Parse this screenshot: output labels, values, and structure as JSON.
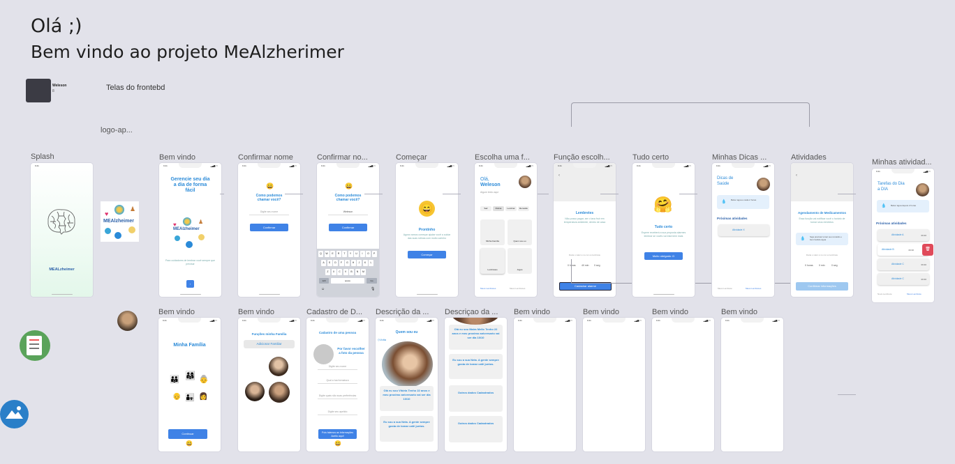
{
  "header": {
    "greeting": "Olá ;)",
    "title": "Bem vindo ao projeto MeAlzherimer"
  },
  "author": {
    "name": "Weleson",
    "sub": "8"
  },
  "section_label": "Telas do frontebd",
  "logo_label": "logo-ap...",
  "frame_labels": {
    "splash": "Splash",
    "bem_vindo": "Bem vindo",
    "confirmar_nome": "Confirmar nome",
    "confirmar_no": "Confirmar no...",
    "comecar": "Começar",
    "escolha": "Escolha uma f...",
    "funcao": "Função escolh...",
    "tudo_certo": "Tudo certo",
    "minhas_dicas": "Minhas Dicas ...",
    "atividades": "Atividades",
    "minhas_atividades": "Minhas atividad...",
    "cadastro": "Cadastro de D...",
    "descricao_a": "Descrição da ...",
    "descricao_b": "Descriçao da ..."
  },
  "status_time": "9:41",
  "splash": {
    "logo": "MEALzheimer"
  },
  "logo_tile": {
    "text": "MEAlzheimer"
  },
  "bem_vindo": {
    "title": "Gerencie seu dia a dia de forma fácil",
    "text": "Para cuidadores de lembrar você sempre que precisar",
    "next": "›"
  },
  "confirmar_nome": {
    "title": "Como podemos chamar você?",
    "placeholder": "Digite seu nome",
    "button": "Confirmar"
  },
  "confirmar_no": {
    "title": "Como podemos chamar você?",
    "value": "Weleson",
    "button": "Confirmar",
    "kb_rows": [
      "QWERTYUIOP",
      "ASDFGHJKL",
      "ZXCVBNM"
    ],
    "kb_num": "123",
    "kb_space": "space",
    "kb_go": "Go"
  },
  "comecar": {
    "title": "Prontinho",
    "text": "Agora vamos começar ajudar você a cuidar das suas rotinas com muito carinho",
    "button": "Começar"
  },
  "escolha": {
    "greeting": "Olá,",
    "name": "Weleson",
    "sub": "Algum texto aqui",
    "chips": [
      "Sair",
      "Rotina",
      "Lembrar",
      "Remédio"
    ],
    "tiles": [
      "Minha Família",
      "Quem sou eu",
      "Lembretes",
      "Jogos"
    ],
    "nav": [
      "Meus Lembretes",
      "Meus Lembretes"
    ]
  },
  "funcao": {
    "title": "Lembretes",
    "text": "Não posso pagar, ser o lava fruir em temperatura ambiente, dentro de casa",
    "q": "Daria o valor é no cor os lembrete",
    "labels": [
      "0 horas",
      "40 min",
      "0 seg"
    ],
    "button": "Cadastrar alarme"
  },
  "tudo_certo": {
    "title": "Tudo certo",
    "text": "Espere receberá a sua proposta alarmes lembrar se vocês vai está bem mais",
    "button": "Muito obrigado :D"
  },
  "minhas_dicas": {
    "title": "Dicas de Saúde",
    "tip": "Beber água a cada 2 horas",
    "upcoming": "Próximas atividades",
    "item": "Atividade X",
    "nav": [
      "Meus Lembrete",
      "Meus Lembretes"
    ]
  },
  "atividades": {
    "title": "Agendamento de Medicamentos",
    "text": "Essa função vai notificar você o horário de tomar seus remédios",
    "tip": "Seja precisar tomar seu remédio e bem bebido água",
    "q": "Daria o valor é no cor os lembrete",
    "labels": [
      "0 horas",
      "0 min",
      "0 seg"
    ],
    "button": "Confirmar informações"
  },
  "minhas_atividades": {
    "title": "Tarefas do Dia a DIA",
    "tip": "Beber água depois 2 horas",
    "upcoming": "Próximas atividades",
    "items": [
      "Atividade A",
      "Atividade B",
      "Atividade C",
      "Atividade C"
    ],
    "time": "09:30",
    "nav": [
      "Nova Lembrete",
      "Meus Lembrete"
    ]
  },
  "familia": {
    "title": "Minha Família",
    "button": "Continuar"
  },
  "funcoes_familia": {
    "title": "Funções minha Família",
    "button": "Adicionar Familiar"
  },
  "cadastro": {
    "title": "Cadastro de uma pessoa",
    "prompt": "Por favor escolher a foto da pessoa",
    "fields": [
      "Digite seu nome",
      "Qual a tua formatura",
      "Digite quais são suas preferências",
      "Digite seu apelido"
    ],
    "button": "Pois falemos as Informações Aceito aqui!"
  },
  "descricao_a": {
    "title": "Quem sou eu",
    "back": "Volta",
    "bio": "Olá eu sou Vitória Tenho 22 anos e meu proximo aniversario vai ser dia 10/10",
    "note": "Eu sou a sua Neta. A gente sempre gosta de tomar café juntos."
  },
  "descricao_b": {
    "bio": "Olá eu sou Maira Mello Tenho 22 anos e meu proximo aniversario vai ser dia 10/10",
    "note": "Eu sou a sua Neta. A gente sempre gosta de tomar café juntos.",
    "other1": "Outros dados Cadastrados",
    "other2": "Outros dados Cadastrados"
  },
  "colors": {
    "bg": "#e2e2ea",
    "accent": "#3f82e6",
    "title_blue": "#2a8ad8"
  }
}
